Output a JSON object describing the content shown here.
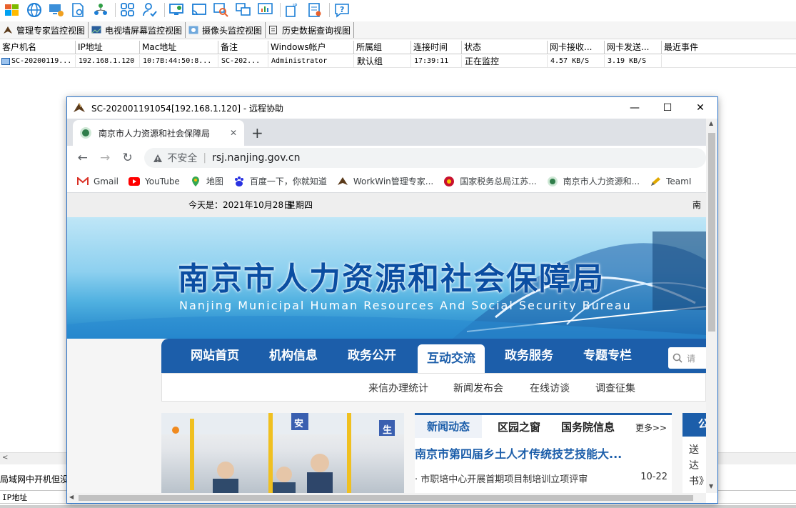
{
  "toolbar": {
    "icons": [
      "windows-icon",
      "network-globe-icon",
      "monitor-settings-icon",
      "file-scan-icon",
      "users-tree-icon",
      "grid-apps-icon",
      "user-check-icon",
      "remote-desktop-icon",
      "cast-icon",
      "search-screen-icon",
      "multi-screen-icon",
      "chart-screen-icon",
      "ip-config-icon",
      "log-report-icon",
      "help-icon"
    ]
  },
  "view_tabs": [
    {
      "label": "管理专家监控视图"
    },
    {
      "label": "电视墙屏幕监控视图"
    },
    {
      "label": "摄像头监控视图"
    },
    {
      "label": "历史数据查询视图"
    }
  ],
  "client_table": {
    "columns": [
      "客户机名",
      "IP地址",
      "Mac地址",
      "备注",
      "Windows帐户",
      "所属组",
      "连接时间",
      "状态",
      "网卡接收...",
      "网卡发送...",
      "最近事件"
    ],
    "rows": [
      [
        "SC-20200119...",
        "192.168.1.120",
        "10:7B:44:50:8...",
        "SC-202...",
        "Administrator",
        "默认组",
        "17:39:11",
        "正在监控",
        "4.57 KB/S",
        "3.19 KB/S",
        ""
      ]
    ]
  },
  "bottom_panel": {
    "title": "局域网中开机但没",
    "columns": [
      "IP地址"
    ]
  },
  "remote_window": {
    "title": "SC-202001191054[192.168.1.120] - 远程协助",
    "minimize": "—",
    "maximize": "☐",
    "close": "✕",
    "browser": {
      "tab_title": "南京市人力资源和社会保障局",
      "tab_close": "✕",
      "new_tab": "+",
      "back": "←",
      "forward": "→",
      "reload": "↻",
      "security_label": "不安全",
      "address": "rsj.nanjing.gov.cn",
      "bookmarks": [
        {
          "label": "Gmail",
          "icon": "gmail-icon",
          "color": "#d93025"
        },
        {
          "label": "YouTube",
          "icon": "youtube-icon",
          "color": "#ff0000"
        },
        {
          "label": "地图",
          "icon": "maps-icon",
          "color": "#34a853"
        },
        {
          "label": "百度一下，你就知道",
          "icon": "baidu-icon",
          "color": "#2932e1"
        },
        {
          "label": "WorkWin管理专家...",
          "icon": "eagle-icon",
          "color": "#5a3a1a"
        },
        {
          "label": "国家税务总局江苏...",
          "icon": "emblem-icon",
          "color": "#c8102e"
        },
        {
          "label": "南京市人力资源和...",
          "icon": "hrss-logo-icon",
          "color": "#2f7d4a"
        },
        {
          "label": "TeamI",
          "icon": "pencil-icon",
          "color": "#e0a800"
        }
      ],
      "page": {
        "date_prefix": "今天是：",
        "date": "2021年10月28日",
        "weekday": "星期四",
        "right_text": "南京",
        "hero_title": "南京市人力资源和社会保障局",
        "hero_subtitle": "Nanjing Municipal Human Resources And Social Security Bureau",
        "nav": [
          "网站首页",
          "机构信息",
          "政务公开",
          "互动交流",
          "政务服务",
          "专题专栏"
        ],
        "search_placeholder": "请",
        "subnav": [
          "来信办理统计",
          "新闻发布会",
          "在线访谈",
          "调查征集"
        ],
        "photo_signs": [
          "安",
          "生"
        ],
        "news_tabs": [
          "新闻动态",
          "区园之窗",
          "国务院信息"
        ],
        "news_more": "更多>>",
        "news_headline": "南京市第四届乡土人才传统技艺技能大...",
        "news_items": [
          {
            "title": "· 市职培中心开展首期项目制培训立项评审",
            "date": "10-22"
          }
        ],
        "notice_header": "公",
        "notice_lines": [
          "送达",
          "书》"
        ]
      }
    }
  }
}
